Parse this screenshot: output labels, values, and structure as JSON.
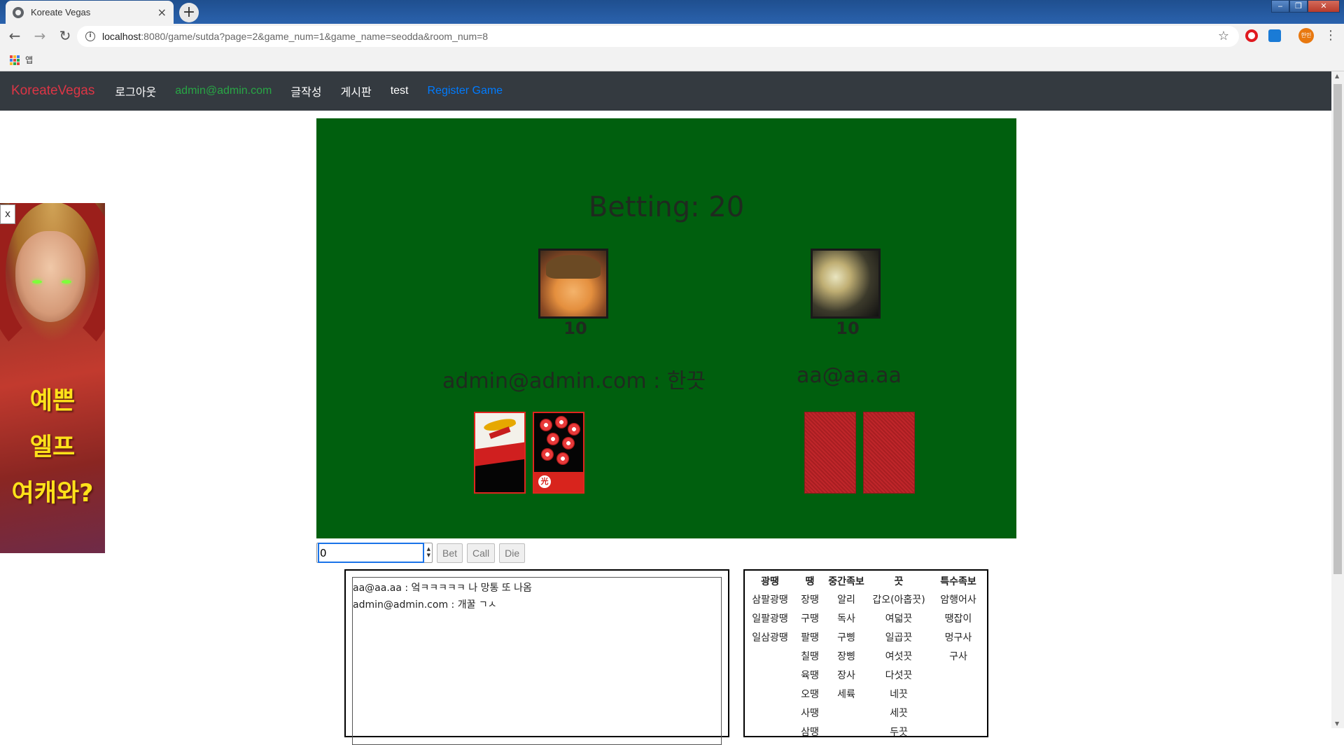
{
  "browser": {
    "tab_title": "Koreate Vegas",
    "tab_close": "×",
    "new_tab": "+",
    "url_host": "localhost",
    "url_rest": ":8080/game/sutda?page=2&game_num=1&game_name=seodda&room_num=8",
    "bookmarks_label": "앱",
    "profile_label": "한민",
    "window_controls": [
      "‒",
      "❐",
      "✕"
    ]
  },
  "navbar": {
    "brand": "KoreateVegas",
    "logout": "로그아웃",
    "user": "admin@admin.com",
    "write": "글작성",
    "board": "게시판",
    "test": "test",
    "register": "Register Game"
  },
  "ad": {
    "close": "x",
    "lines": [
      "예쁜",
      "엘프",
      "여캐와?"
    ]
  },
  "game": {
    "betting": "Betting: 20",
    "player1": {
      "chips": "10",
      "name": "admin@admin.com : 한끗"
    },
    "player2": {
      "chips": "10",
      "name": "aa@aa.aa"
    },
    "gwang_mark": "光"
  },
  "controls": {
    "bet_value": "0",
    "bet_button": "Bet",
    "call_button": "Call",
    "die_button": "Die"
  },
  "chat": {
    "messages": [
      "aa@aa.aa : 엌ㅋㅋㅋㅋㅋ 나 망통 또 나옴",
      "admin@admin.com : 개꿀 ㄱㅅ"
    ]
  },
  "ranks": {
    "headers": [
      "광땡",
      "땡",
      "중간족보",
      "끗",
      "특수족보"
    ],
    "rows": [
      [
        "삼팔광땡",
        "장땡",
        "알리",
        "갑오(아홉끗)",
        "암행어사"
      ],
      [
        "일팔광땡",
        "구땡",
        "독사",
        "여덟끗",
        "땡잡이"
      ],
      [
        "일삼광땡",
        "팔땡",
        "구삥",
        "일곱끗",
        "멍구사"
      ],
      [
        "",
        "칠땡",
        "장삥",
        "여섯끗",
        "구사"
      ],
      [
        "",
        "육땡",
        "장사",
        "다섯끗",
        ""
      ],
      [
        "",
        "오땡",
        "세륙",
        "네끗",
        ""
      ],
      [
        "",
        "사땡",
        "",
        "세끗",
        ""
      ],
      [
        "",
        "삼땡",
        "",
        "두끗",
        ""
      ]
    ]
  }
}
